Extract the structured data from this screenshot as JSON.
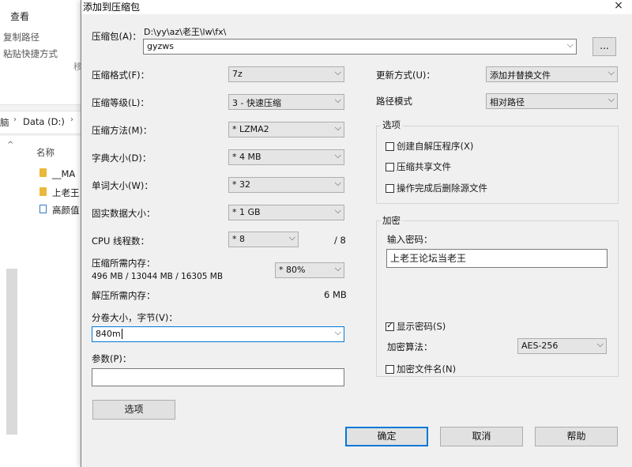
{
  "explorer": {
    "tab_view": "查看",
    "ribbon": [
      "复制路径",
      "粘贴快捷方式"
    ],
    "ribbon_cut_char": "移",
    "address_prefix": "脑",
    "address": "Data (D:)",
    "column_name": "名称",
    "files": [
      "__MA",
      "上老王",
      "高颜值"
    ]
  },
  "dialog": {
    "title": "添加到压缩包",
    "close": "×",
    "archive_label": "压缩包(A)：",
    "archive_path": "D:\\yy\\az\\老王\\lw\\fx\\",
    "archive_name": "gyzws",
    "browse": "...",
    "left": {
      "format": {
        "label": "压缩格式(F)：",
        "value": "7z"
      },
      "level": {
        "label": "压缩等级(L)：",
        "value": "3 - 快速压缩"
      },
      "method": {
        "label": "压缩方法(M)：",
        "value": "* LZMA2"
      },
      "dict": {
        "label": "字典大小(D)：",
        "value": "* 4 MB"
      },
      "word": {
        "label": "单词大小(W)：",
        "value": "* 32"
      },
      "solid": {
        "label": "固实数据大小：",
        "value": "* 1 GB"
      },
      "threads": {
        "label": "CPU 线程数：",
        "value": "* 8",
        "max": "/ 8"
      },
      "mem_compress": {
        "label": "压缩所需内存：",
        "detail": "496 MB / 13044 MB / 16305 MB",
        "value": "* 80%"
      },
      "mem_decompress": {
        "label": "解压所需内存：",
        "value": "6 MB"
      },
      "split": {
        "label": "分卷大小，字节(V)：",
        "value": "840m"
      },
      "params": {
        "label": "参数(P)：",
        "value": ""
      },
      "options_btn": "选项"
    },
    "right": {
      "update": {
        "label": "更新方式(U)：",
        "value": "添加并替换文件"
      },
      "path": {
        "label": "路径模式",
        "value": "相对路径"
      },
      "options_group": {
        "title": "选项",
        "items": [
          {
            "label": "创建自解压程序(X)",
            "checked": false
          },
          {
            "label": "压缩共享文件",
            "checked": false
          },
          {
            "label": "操作完成后删除源文件",
            "checked": false
          }
        ]
      },
      "encryption": {
        "title": "加密",
        "password_label": "输入密码：",
        "password": "上老王论坛当老王",
        "show_password": {
          "label": "显示密码(S)",
          "checked": true
        },
        "method_label": "加密算法：",
        "method": "AES-256",
        "encrypt_names": {
          "label": "加密文件名(N)",
          "checked": false
        }
      }
    },
    "buttons": {
      "ok": "确定",
      "cancel": "取消",
      "help": "帮助"
    }
  }
}
